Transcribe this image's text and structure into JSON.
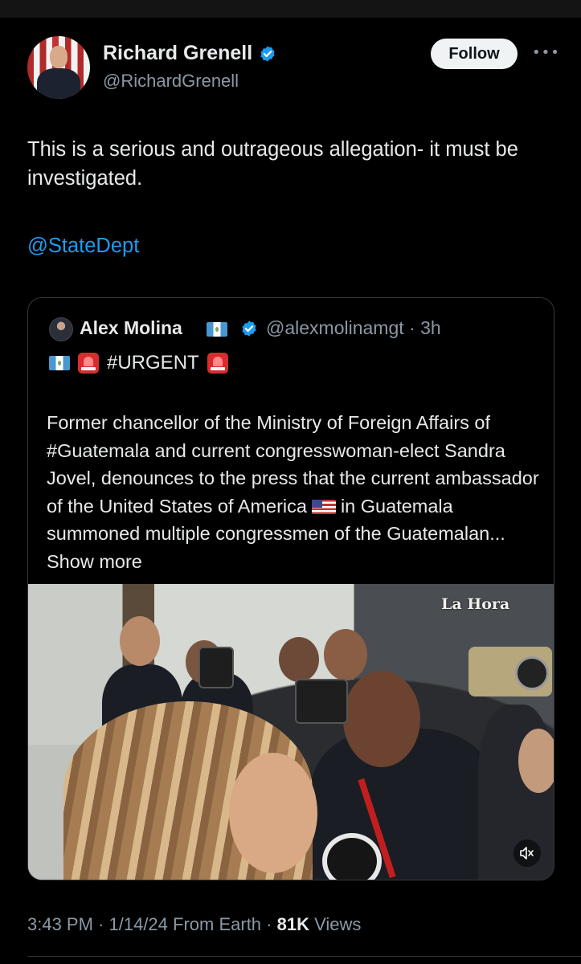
{
  "tweet": {
    "author": {
      "name": "Richard Grenell",
      "handle": "@RichardGrenell",
      "verified": true,
      "avatar_icon": "profile-photo"
    },
    "follow_label": "Follow",
    "more_icon": "more-horizontal-icon",
    "text": "This is a serious and outrageous allegation- it must be investigated.",
    "mention": "@StateDept",
    "meta": {
      "time": "3:43 PM",
      "sep1": " · ",
      "date": "1/14/24",
      "source": " From Earth",
      "sep2": " · ",
      "views_count": "81K",
      "views_label": " Views"
    }
  },
  "quoted": {
    "author": {
      "name": "Alex Molina",
      "handle": "@alexmolinamgt",
      "time": " · 3h",
      "verified": true,
      "flag_icon": "guatemala-flag-icon"
    },
    "urgent": "#URGENT",
    "body_part1": "Former chancellor of the Ministry of Foreign Affairs of #Guatemala and current congresswoman-elect Sandra Jovel, denounces to the press that the current ambassador of the United States of America",
    "body_part2": "in Guatemala summoned multiple congressmen of the Guatemalan...",
    "show_more": "Show more",
    "video": {
      "watermark": "La Hora",
      "mute_icon": "volume-muted-icon"
    }
  },
  "colors": {
    "background": "#000000",
    "text": "#e7e9ea",
    "secondary": "#8b98a5",
    "link": "#1d9bf0",
    "verified": "#1d9bf0",
    "border": "#333639"
  }
}
